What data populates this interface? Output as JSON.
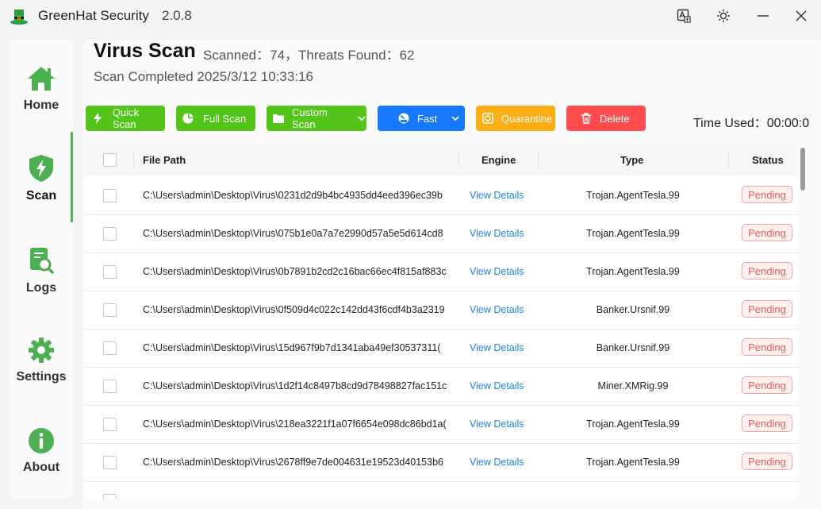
{
  "app": {
    "title": "GreenHat Security",
    "version": "2.0.8"
  },
  "titlebar_icons": [
    "translate-icon",
    "sun-icon",
    "minimize-icon",
    "close-icon"
  ],
  "sidebar": {
    "items": [
      {
        "label": "Home",
        "icon": "home-icon"
      },
      {
        "label": "Scan",
        "icon": "shield-bolt-icon",
        "active": true
      },
      {
        "label": "Logs",
        "icon": "log-search-icon"
      },
      {
        "label": "Settings",
        "icon": "gear-icon"
      },
      {
        "label": "About",
        "icon": "info-icon"
      }
    ]
  },
  "header": {
    "title": "Virus Scan",
    "stats": "Scanned：74，Threats Found：62",
    "completed": "Scan Completed 2025/3/12 10:33:16"
  },
  "toolbar": {
    "quick_scan": "Quick Scan",
    "full_scan": "Full Scan",
    "custom_scan": "Custom Scan",
    "speed": "Fast",
    "quarantine": "Quarantine",
    "delete": "Delete",
    "time_used": "Time Used：00:00:0"
  },
  "colors": {
    "green": "#52c41a",
    "blue": "#1677ff",
    "orange": "#faad14",
    "red": "#ff4d4f",
    "accent": "#4caf50"
  },
  "table": {
    "columns": {
      "path": "File Path",
      "engine": "Engine",
      "type": "Type",
      "status": "Status"
    },
    "rows": [
      {
        "path": "C:\\Users\\admin\\Desktop\\Virus\\0231d2d9b4bc4935dd4eed396ec39b",
        "engine": "View Details",
        "type": "Trojan.AgentTesla.99",
        "status": "Pending"
      },
      {
        "path": "C:\\Users\\admin\\Desktop\\Virus\\075b1e0a7a7e2990d57a5e5d614cd8",
        "engine": "View Details",
        "type": "Trojan.AgentTesla.99",
        "status": "Pending"
      },
      {
        "path": "C:\\Users\\admin\\Desktop\\Virus\\0b7891b2cd2c16bac66ec4f815af883c",
        "engine": "View Details",
        "type": "Trojan.AgentTesla.99",
        "status": "Pending"
      },
      {
        "path": "C:\\Users\\admin\\Desktop\\Virus\\0f509d4c022c142dd43f6cdf4b3a2319",
        "engine": "View Details",
        "type": "Banker.Ursnif.99",
        "status": "Pending"
      },
      {
        "path": "C:\\Users\\admin\\Desktop\\Virus\\15d967f9b7d1341aba49ef30537311(",
        "engine": "View Details",
        "type": "Banker.Ursnif.99",
        "status": "Pending"
      },
      {
        "path": "C:\\Users\\admin\\Desktop\\Virus\\1d2f14c8497b8cd9d78498827fac151c",
        "engine": "View Details",
        "type": "Miner.XMRig.99",
        "status": "Pending"
      },
      {
        "path": "C:\\Users\\admin\\Desktop\\Virus\\218ea3221f1a07f6654e098dc86bd1a(",
        "engine": "View Details",
        "type": "Trojan.AgentTesla.99",
        "status": "Pending"
      },
      {
        "path": "C:\\Users\\admin\\Desktop\\Virus\\2678ff9e7de004631e19523d40153b6",
        "engine": "View Details",
        "type": "Trojan.AgentTesla.99",
        "status": "Pending"
      }
    ]
  }
}
